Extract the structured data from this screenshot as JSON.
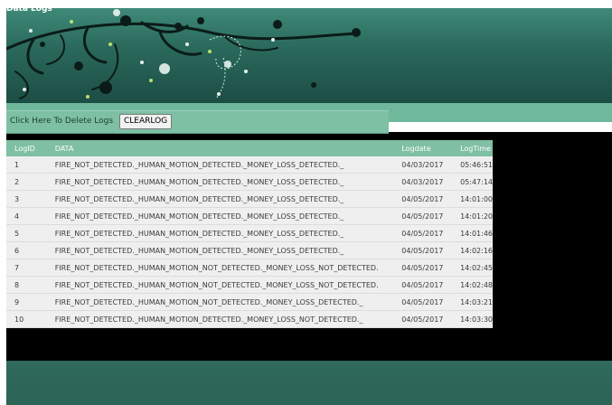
{
  "page_title": "Data Logs",
  "action": {
    "label": "Click Here To Delete Logs",
    "button_label": "CLEARLOG"
  },
  "table": {
    "headers": [
      "LogID",
      "DATA",
      "Logdate",
      "LogTime"
    ],
    "rows": [
      {
        "id": "1",
        "data": "FIRE_NOT_DETECTED._HUMAN_MOTION_DETECTED._MONEY_LOSS_DETECTED._",
        "date": "04/03/2017",
        "time": "05:46:51"
      },
      {
        "id": "2",
        "data": "FIRE_NOT_DETECTED._HUMAN_MOTION_DETECTED._MONEY_LOSS_DETECTED._",
        "date": "04/03/2017",
        "time": "05:47:14"
      },
      {
        "id": "3",
        "data": "FIRE_NOT_DETECTED._HUMAN_MOTION_DETECTED._MONEY_LOSS_DETECTED._",
        "date": "04/05/2017",
        "time": "14:01:00"
      },
      {
        "id": "4",
        "data": "FIRE_NOT_DETECTED._HUMAN_MOTION_DETECTED._MONEY_LOSS_DETECTED._",
        "date": "04/05/2017",
        "time": "14:01:20"
      },
      {
        "id": "5",
        "data": "FIRE_NOT_DETECTED._HUMAN_MOTION_DETECTED._MONEY_LOSS_DETECTED._",
        "date": "04/05/2017",
        "time": "14:01:46"
      },
      {
        "id": "6",
        "data": "FIRE_NOT_DETECTED._HUMAN_MOTION_DETECTED._MONEY_LOSS_DETECTED._",
        "date": "04/05/2017",
        "time": "14:02:16"
      },
      {
        "id": "7",
        "data": "FIRE_NOT_DETECTED._HUMAN_MOTION_NOT_DETECTED._MONEY_LOSS_NOT_DETECTED.",
        "date": "04/05/2017",
        "time": "14:02:45"
      },
      {
        "id": "8",
        "data": "FIRE_NOT_DETECTED._HUMAN_MOTION_NOT_DETECTED._MONEY_LOSS_NOT_DETECTED.",
        "date": "04/05/2017",
        "time": "14:02:48"
      },
      {
        "id": "9",
        "data": "FIRE_NOT_DETECTED._HUMAN_MOTION_NOT_DETECTED._MONEY_LOSS_DETECTED._",
        "date": "04/05/2017",
        "time": "14:03:21"
      },
      {
        "id": "10",
        "data": "FIRE_NOT_DETECTED._HUMAN_MOTION_DETECTED._MONEY_LOSS_NOT_DETECTED._",
        "date": "04/05/2017",
        "time": "14:03:30"
      }
    ]
  },
  "colors": {
    "header_green": "#2b6a5d",
    "band_green": "#7dc0a4",
    "table_header": "#7fbfa3",
    "row_bg": "#efefef",
    "dark": "#000000"
  },
  "icons": [
    "floral-swirl-decoration"
  ]
}
